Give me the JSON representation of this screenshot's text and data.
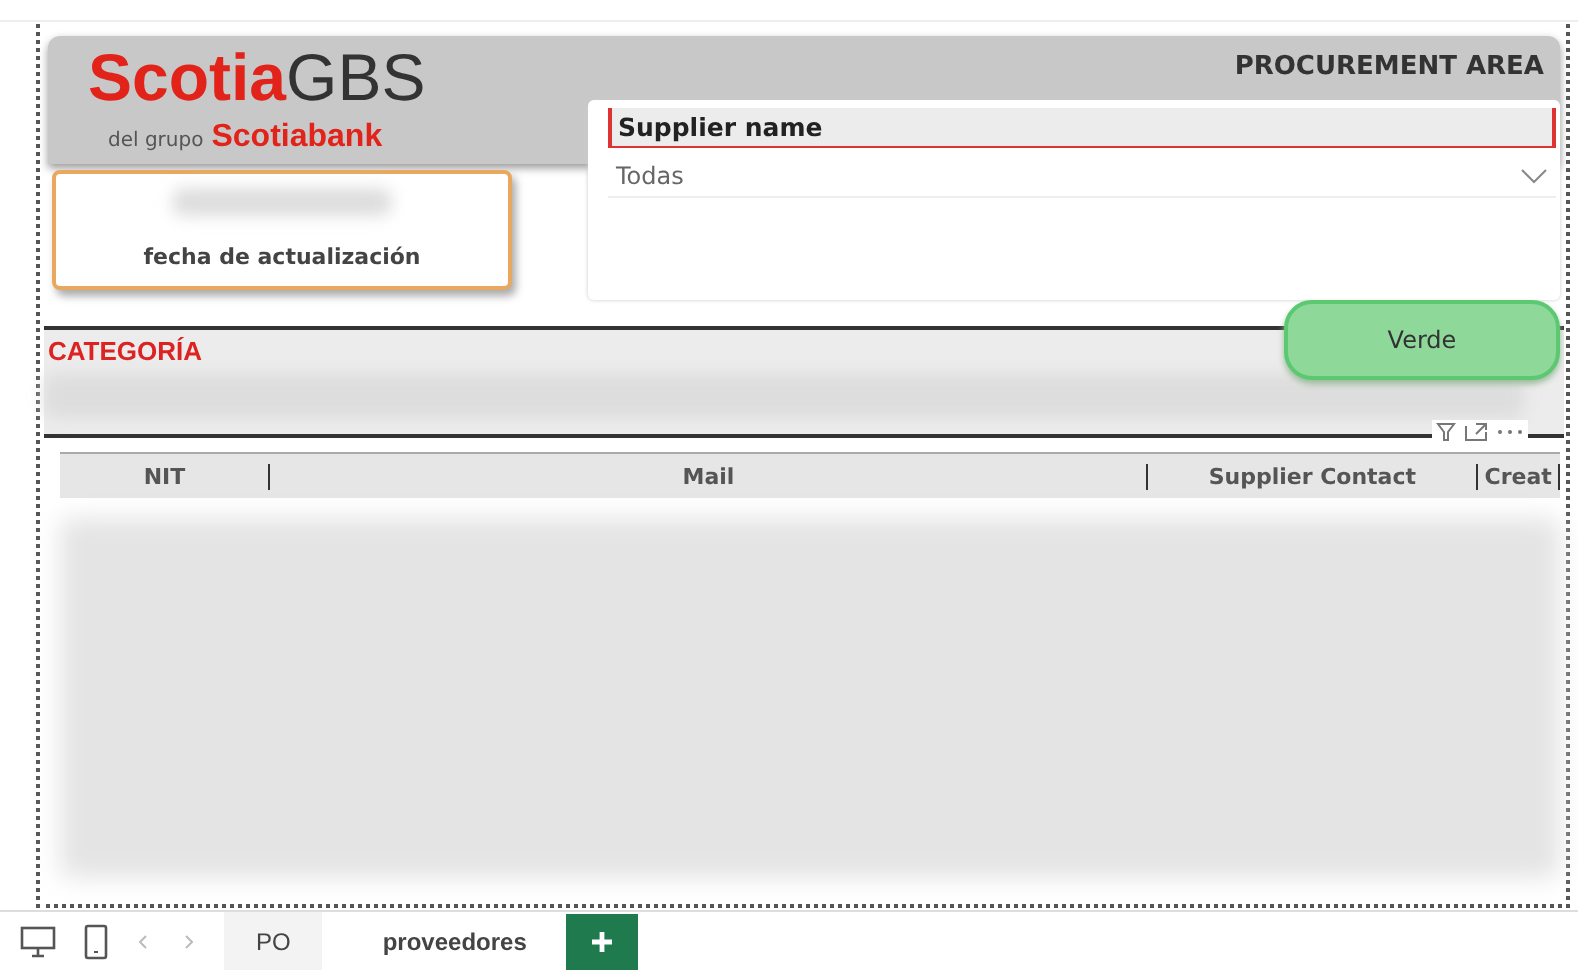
{
  "header": {
    "logo": {
      "brand": "Scotia",
      "brand_suffix": "GBS",
      "tagline": "del grupo",
      "bank": "Scotiabank"
    },
    "area": "PROCUREMENT AREA"
  },
  "date_card": {
    "label": "fecha de actualización"
  },
  "slicer": {
    "title": "Supplier name",
    "value": "Todas"
  },
  "category": {
    "title": "CATEGORÍA"
  },
  "verde_button": {
    "label": "Verde"
  },
  "table": {
    "columns": [
      "NIT",
      "Mail",
      "Supplier Contact",
      "Creat"
    ]
  },
  "page_tabs": [
    {
      "label": "PO",
      "selected": false
    },
    {
      "label": "proveedores",
      "selected": true
    }
  ]
}
